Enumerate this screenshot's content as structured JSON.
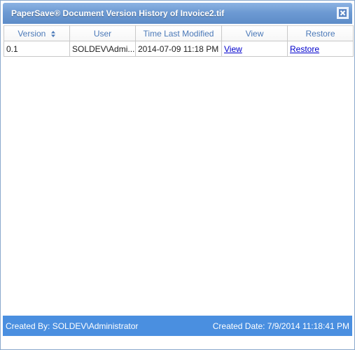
{
  "window": {
    "title": "PaperSave® Document Version History of Invoice2.tif",
    "close_icon": "close-icon"
  },
  "grid": {
    "columns": [
      "Version",
      "User",
      "Time Last Modified",
      "View",
      "Restore"
    ],
    "sort_icon": "sort-updown-icon",
    "rows": [
      {
        "version": "0.1",
        "user": "SOLDEV\\Admi...",
        "time_last_modified": "2014-07-09 11:18 PM",
        "view_link": "View",
        "restore_link": "Restore"
      }
    ]
  },
  "footer": {
    "created_by": "Created By: SOLDEV\\Administrator",
    "created_date": "Created Date: 7/9/2014 11:18:41 PM"
  },
  "colors": {
    "title_gradient_top": "#8cb3e3",
    "title_gradient_bottom": "#5d8cc8",
    "header_text": "#4b79b8",
    "footer_bg": "#4a8fe0",
    "link": "#0000cc"
  }
}
